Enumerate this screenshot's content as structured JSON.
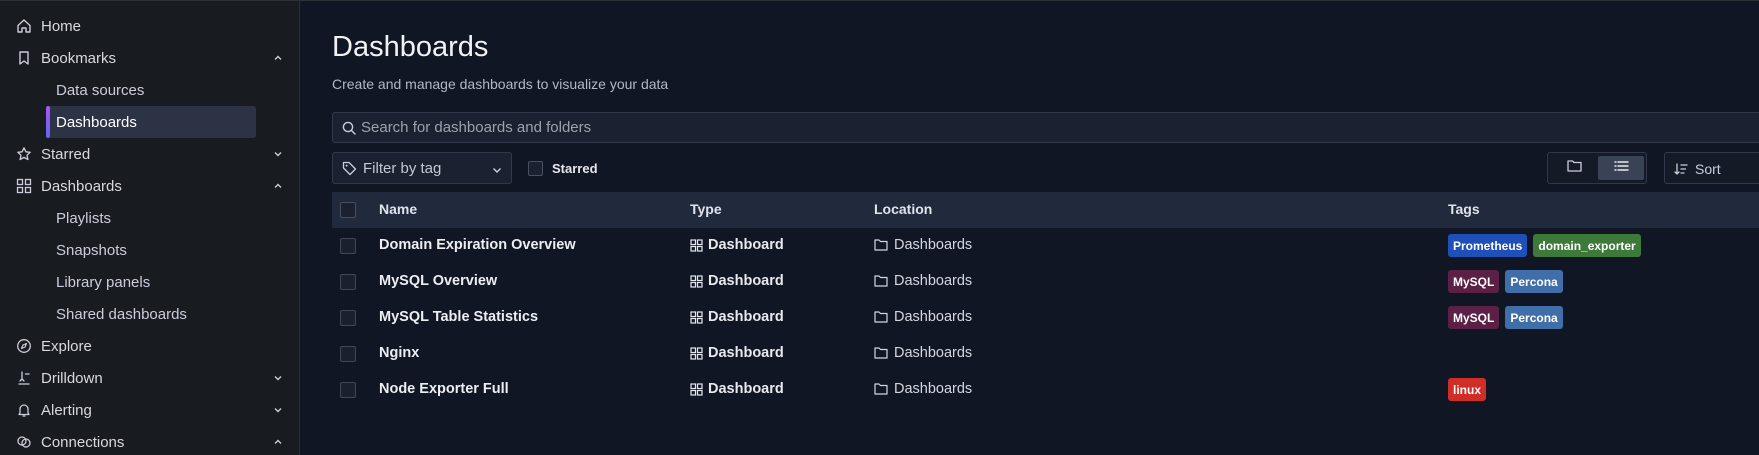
{
  "sidebar": {
    "items": [
      {
        "label": "Home",
        "icon": "home-icon"
      },
      {
        "label": "Bookmarks",
        "icon": "bookmark-icon",
        "expanded": true
      },
      {
        "label": "Starred",
        "icon": "star-icon",
        "expanded": false
      },
      {
        "label": "Dashboards",
        "icon": "apps-icon",
        "expanded": true
      },
      {
        "label": "Explore",
        "icon": "compass-icon"
      },
      {
        "label": "Drilldown",
        "icon": "drilldown-icon",
        "expanded": false
      },
      {
        "label": "Alerting",
        "icon": "bell-icon",
        "expanded": false
      },
      {
        "label": "Connections",
        "icon": "plug-icon",
        "expanded": true
      }
    ],
    "bookmarks_children": [
      "Data sources",
      "Dashboards"
    ],
    "dashboards_children": [
      "Playlists",
      "Snapshots",
      "Library panels",
      "Shared dashboards"
    ],
    "active_item": "Dashboards"
  },
  "main": {
    "title": "Dashboards",
    "subtitle": "Create and manage dashboards to visualize your data",
    "search_placeholder": "Search for dashboards and folders",
    "filter_tag_label": "Filter by tag",
    "starred_label": "Starred",
    "sort_label": "Sort",
    "view_mode": "list"
  },
  "table": {
    "columns": [
      "Name",
      "Type",
      "Location",
      "Tags"
    ],
    "rows": [
      {
        "name": "Domain Expiration Overview",
        "type": "Dashboard",
        "location": "Dashboards",
        "tags": [
          {
            "label": "Prometheus",
            "color": "#1f4fb8"
          },
          {
            "label": "domain_exporter",
            "color": "#3d7a3a"
          }
        ]
      },
      {
        "name": "MySQL Overview",
        "type": "Dashboard",
        "location": "Dashboards",
        "tags": [
          {
            "label": "MySQL",
            "color": "#5c1f45"
          },
          {
            "label": "Percona",
            "color": "#3f6ea8"
          }
        ]
      },
      {
        "name": "MySQL Table Statistics",
        "type": "Dashboard",
        "location": "Dashboards",
        "tags": [
          {
            "label": "MySQL",
            "color": "#5c1f45"
          },
          {
            "label": "Percona",
            "color": "#3f6ea8"
          }
        ]
      },
      {
        "name": "Nginx",
        "type": "Dashboard",
        "location": "Dashboards",
        "tags": []
      },
      {
        "name": "Node Exporter Full",
        "type": "Dashboard",
        "location": "Dashboards",
        "tags": [
          {
            "label": "linux",
            "color": "#d02d26"
          }
        ]
      }
    ]
  },
  "colors": {
    "background": "#111624",
    "sidebar": "#181b1f",
    "active_accent": "#a855f7"
  }
}
